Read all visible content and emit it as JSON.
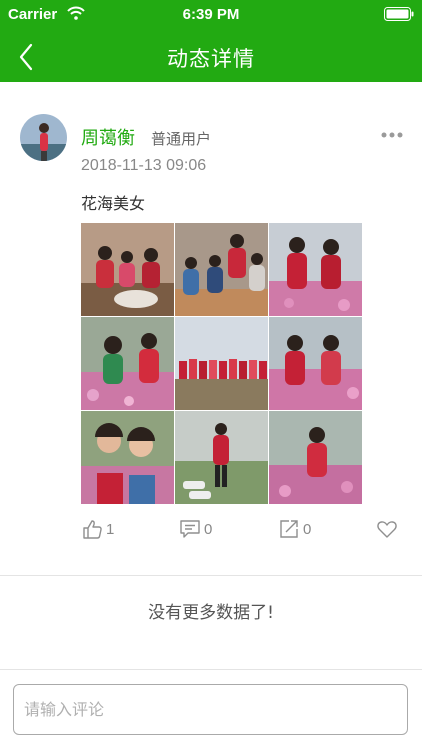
{
  "status_bar": {
    "carrier": "Carrier",
    "time": "6:39 PM"
  },
  "header": {
    "title": "动态详情"
  },
  "post": {
    "author_name": "周蔼衡",
    "author_role": "普通用户",
    "timestamp": "2018-11-13 09:06",
    "content": "花海美女",
    "photo_count": 9,
    "likes": "1",
    "comments": "0",
    "shares": "0"
  },
  "footer": {
    "no_more_text": "没有更多数据了!"
  },
  "comment_input": {
    "placeholder": "请输入评论",
    "value": ""
  },
  "colors": {
    "brand_green": "#22aa12",
    "muted_text": "#888888"
  },
  "icons": [
    "back-arrow-icon",
    "wifi-icon",
    "battery-icon",
    "more-icon",
    "like-icon",
    "comment-icon",
    "share-icon",
    "heart-icon"
  ]
}
